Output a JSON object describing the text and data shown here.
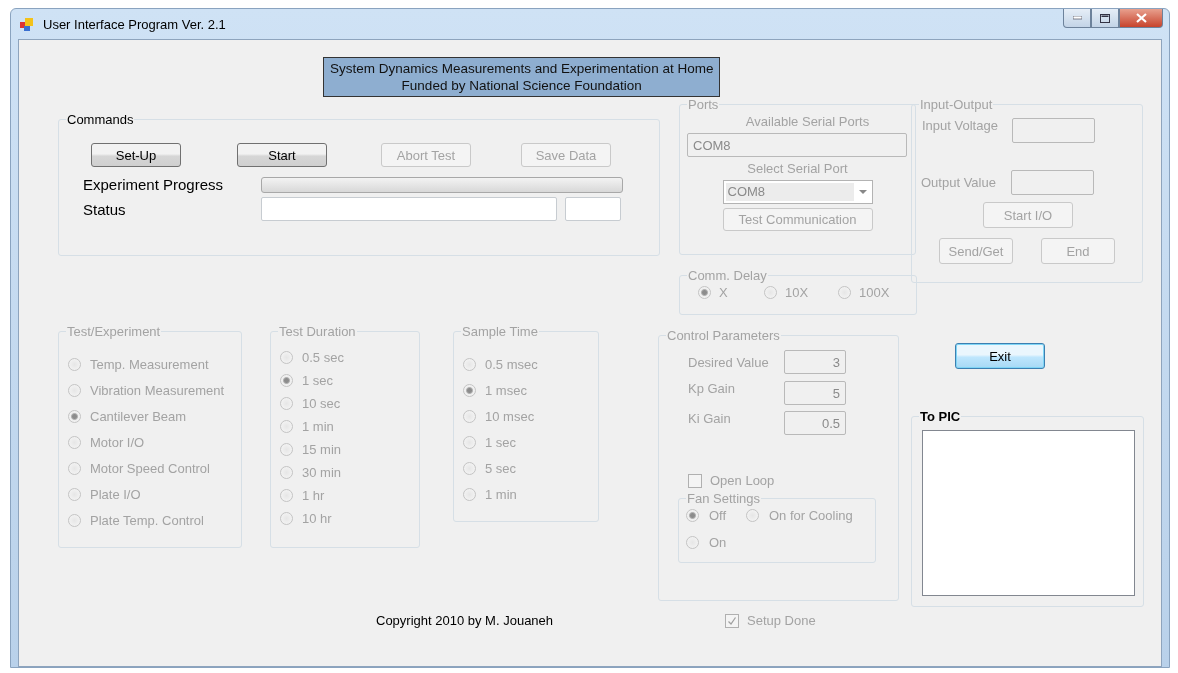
{
  "window": {
    "title": "User Interface Program Ver. 2.1"
  },
  "banner": [
    "System Dynamics Measurements and Experimentation at Home",
    "Funded by National Science Foundation"
  ],
  "commands": {
    "title": "Commands",
    "buttons": [
      {
        "label": "Set-Up",
        "disabled": false
      },
      {
        "label": "Start",
        "disabled": false
      },
      {
        "label": "Abort Test",
        "disabled": true
      },
      {
        "label": "Save Data",
        "disabled": true
      }
    ],
    "progress": {
      "label": "Experiment Progress",
      "level": 0
    },
    "status": {
      "label": "Status"
    }
  },
  "test_experiment": {
    "title": "Test/Experiment",
    "disabled": true,
    "options": [
      {
        "label": "Temp. Measurement",
        "selected": false
      },
      {
        "label": "Vibration Measurement",
        "selected": false
      },
      {
        "label": "Cantilever Beam",
        "selected": true
      },
      {
        "label": "Motor I/O",
        "selected": false
      },
      {
        "label": "Motor Speed Control",
        "selected": false
      },
      {
        "label": "Plate I/O",
        "selected": false
      },
      {
        "label": "Plate Temp. Control",
        "selected": false
      }
    ]
  },
  "test_duration": {
    "title": "Test Duration",
    "disabled": true,
    "options": [
      {
        "label": "0.5 sec",
        "selected": false
      },
      {
        "label": "1 sec",
        "selected": true
      },
      {
        "label": "10 sec",
        "selected": false
      },
      {
        "label": "1 min",
        "selected": false
      },
      {
        "label": "15 min",
        "selected": false
      },
      {
        "label": "30 min",
        "selected": false
      },
      {
        "label": "1 hr",
        "selected": false
      },
      {
        "label": "10 hr",
        "selected": false
      }
    ]
  },
  "sample_time": {
    "title": "Sample Time",
    "disabled": true,
    "options": [
      {
        "label": "0.5 msec",
        "selected": false
      },
      {
        "label": "1 msec",
        "selected": true
      },
      {
        "label": "10 msec",
        "selected": false
      },
      {
        "label": "1 sec",
        "selected": false
      },
      {
        "label": "5 sec",
        "selected": false
      },
      {
        "label": "1 min",
        "selected": false
      }
    ]
  },
  "copyright": "Copyright  2010 by M. Jouaneh",
  "ports": {
    "title": "Ports",
    "disabled": true,
    "available_label": "Available Serial Ports",
    "available_value": "COM8",
    "select_label": "Select Serial Port",
    "select_value": "COM8",
    "button": "Test Communication"
  },
  "comm_delay": {
    "title": "Comm. Delay",
    "disabled": true,
    "options": [
      {
        "label": "X",
        "selected": true
      },
      {
        "label": "10X",
        "selected": false
      },
      {
        "label": "100X",
        "selected": false
      }
    ]
  },
  "control_parameters": {
    "title": "Control Parameters",
    "disabled": true,
    "fields": [
      {
        "label": "Desired Value",
        "value": "3"
      },
      {
        "label": "Kp Gain",
        "value": "5"
      },
      {
        "label": "Ki Gain",
        "value": "0.5"
      }
    ],
    "open_loop": {
      "label": "Open Loop",
      "checked": false
    },
    "fan_settings": {
      "title": "Fan Settings",
      "options": [
        {
          "label": "Off",
          "selected": true
        },
        {
          "label": "On for Cooling",
          "selected": false
        },
        {
          "label": "On",
          "selected": false
        }
      ]
    }
  },
  "setup_done": {
    "label": "Setup Done",
    "checked": true,
    "disabled": true
  },
  "input_output": {
    "title": "Input-Output",
    "disabled": true,
    "input_label": "Input Voltage",
    "output_label": "Output Value",
    "buttons": [
      "Start I/O",
      "Send/Get",
      "End"
    ]
  },
  "exit_button": "Exit",
  "to_pic": {
    "title": "To PIC"
  }
}
